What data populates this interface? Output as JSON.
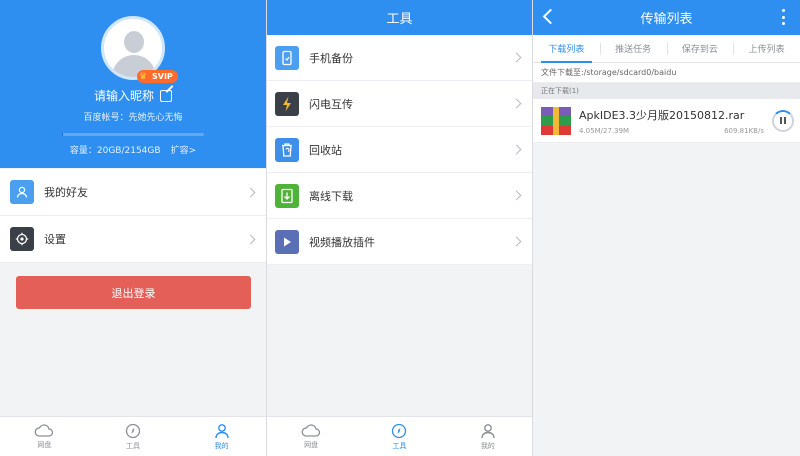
{
  "profile": {
    "badge": "SVIP",
    "nickname": "请输入昵称",
    "account_label": "百度帐号：先她先心无悔",
    "quota_label": "容量：20GB/2154GB",
    "quota_fraction": 0.01,
    "expand_label": "扩容>",
    "menu": [
      {
        "label": "我的好友",
        "icon": "friends-icon",
        "color": "#4a9ff0"
      },
      {
        "label": "设置",
        "icon": "settings-gear-icon",
        "color": "#3b3f47"
      }
    ],
    "logout_label": "退出登录",
    "tabbar": [
      {
        "label": "网盘",
        "icon": "cloud-icon"
      },
      {
        "label": "工具",
        "icon": "compass-icon"
      },
      {
        "label": "我的",
        "icon": "person-icon",
        "active": true
      }
    ]
  },
  "tools": {
    "title": "工具",
    "items": [
      {
        "label": "手机备份",
        "icon": "phone-backup-icon",
        "color": "#4a9ff0"
      },
      {
        "label": "闪电互传",
        "icon": "lightning-icon",
        "color": "#3b3f47"
      },
      {
        "label": "回收站",
        "icon": "recycle-bin-icon",
        "color": "#3d8fe8"
      },
      {
        "label": "离线下载",
        "icon": "offline-download-icon",
        "color": "#4fb339"
      },
      {
        "label": "视频播放插件",
        "icon": "video-play-icon",
        "color": "#5a6fb5"
      }
    ],
    "tabbar": [
      {
        "label": "网盘",
        "icon": "cloud-icon"
      },
      {
        "label": "工具",
        "icon": "compass-icon",
        "active": true
      },
      {
        "label": "我的",
        "icon": "person-icon"
      }
    ]
  },
  "transfer": {
    "title": "传输列表",
    "tabs": [
      "下载列表",
      "推送任务",
      "保存到云",
      "上传列表"
    ],
    "active_tab": 0,
    "path": "文件下载至:/storage/sdcard0/baidu",
    "section": "正在下载(1)",
    "item": {
      "name": "ApkIDE3.3少月版20150812.rar",
      "size": "4.05M/27.39M",
      "speed": "609.81KB/s"
    }
  },
  "colors": {
    "brand_blue": "#2f8ff0",
    "logout_red": "#e35f58"
  }
}
